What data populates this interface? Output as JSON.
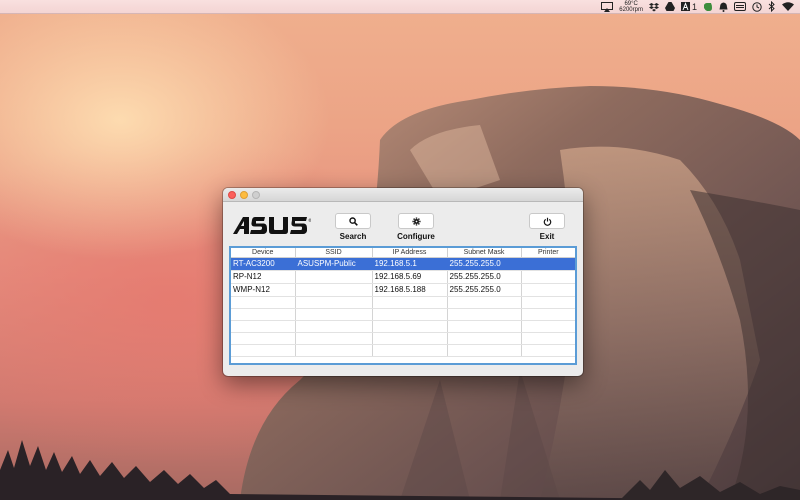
{
  "menubar": {
    "temperature": "69°C",
    "fan_speed": "6200rpm",
    "notification_count": "1",
    "icons": [
      "airplay-icon",
      "dropbox-icon",
      "drive-icon",
      "adobe-icon",
      "evernote-icon",
      "notifications-icon",
      "battery-icon",
      "time-machine-icon",
      "bluetooth-icon",
      "wifi-icon"
    ]
  },
  "window": {
    "brand": "ASUS",
    "toolbar": {
      "search_label": "Search",
      "configure_label": "Configure",
      "exit_label": "Exit"
    },
    "table": {
      "headers": [
        "Device",
        "SSID",
        "IP Address",
        "Subnet Mask",
        "Printer"
      ],
      "rows": [
        {
          "device": "RT-AC3200",
          "ssid": "ASUSPM-Public",
          "ip": "192.168.5.1",
          "subnet": "255.255.255.0",
          "printer": "",
          "selected": true
        },
        {
          "device": "RP-N12",
          "ssid": "",
          "ip": "192.168.5.69",
          "subnet": "255.255.255.0",
          "printer": "",
          "selected": false
        },
        {
          "device": "WMP-N12",
          "ssid": "",
          "ip": "192.168.5.188",
          "subnet": "255.255.255.0",
          "printer": "",
          "selected": false
        }
      ],
      "empty_rows": 5
    }
  },
  "colors": {
    "selection": "#3b6fd6",
    "table_border": "#5b9cd6"
  }
}
